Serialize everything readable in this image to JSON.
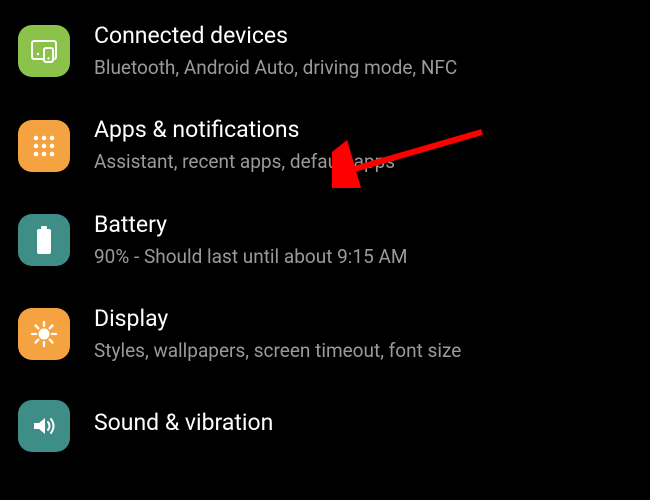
{
  "settings": {
    "items": [
      {
        "key": "connected-devices",
        "title": "Connected devices",
        "subtitle": "Bluetooth, Android Auto, driving mode, NFC",
        "icon_name": "devices-icon",
        "icon_bg": "#8bc34a"
      },
      {
        "key": "apps-notifications",
        "title": "Apps & notifications",
        "subtitle": "Assistant, recent apps, default apps",
        "icon_name": "apps-icon",
        "icon_bg": "#f5a341"
      },
      {
        "key": "battery",
        "title": "Battery",
        "subtitle": "90% - Should last until about 9:15 AM",
        "icon_name": "battery-icon",
        "icon_bg": "#3f8d87"
      },
      {
        "key": "display",
        "title": "Display",
        "subtitle": "Styles, wallpapers, screen timeout, font size",
        "icon_name": "brightness-icon",
        "icon_bg": "#f5a341"
      },
      {
        "key": "sound-vibration",
        "title": "Sound & vibration",
        "subtitle": "",
        "icon_name": "sound-icon",
        "icon_bg": "#3f8d87"
      }
    ]
  },
  "annotation": {
    "arrow_target": "apps-notifications",
    "color": "#ff0000"
  }
}
